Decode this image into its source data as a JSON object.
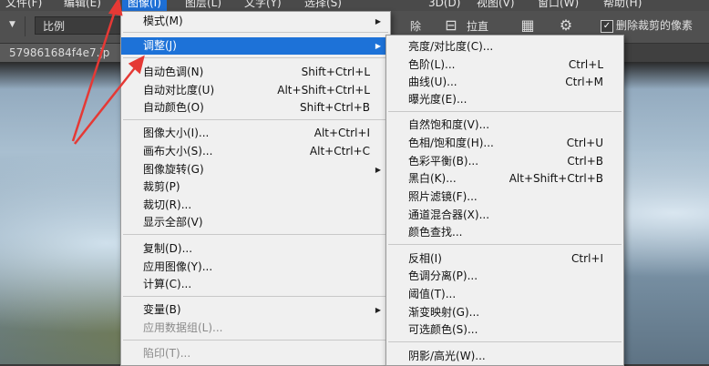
{
  "menubar": {
    "items": [
      "文件(F)",
      "编辑(E)",
      "图像(I)",
      "图层(L)",
      "文字(Y)",
      "选择(S)",
      "3D(D)",
      "视图(V)",
      "窗口(W)",
      "帮助(H)"
    ]
  },
  "options_bar": {
    "ratio_value": "比例",
    "delete_btn": "除",
    "straighten_btn": "拉直",
    "grid_icon": "grid-icon",
    "settings_icon": "gear-icon",
    "delete_cropped_checked": true,
    "delete_cropped_label": "删除裁剪的像素"
  },
  "document": {
    "tab_title": "579861684f4e7.jp"
  },
  "image_menu": {
    "items": [
      {
        "label": "模式(M)",
        "shortcut": "",
        "submenu": true
      },
      {
        "label": "调整(J)",
        "shortcut": "",
        "submenu": true
      },
      {
        "label": "自动色调(N)",
        "shortcut": "Shift+Ctrl+L"
      },
      {
        "label": "自动对比度(U)",
        "shortcut": "Alt+Shift+Ctrl+L"
      },
      {
        "label": "自动颜色(O)",
        "shortcut": "Shift+Ctrl+B"
      },
      {
        "label": "图像大小(I)...",
        "shortcut": "Alt+Ctrl+I"
      },
      {
        "label": "画布大小(S)...",
        "shortcut": "Alt+Ctrl+C"
      },
      {
        "label": "图像旋转(G)",
        "shortcut": "",
        "submenu": true
      },
      {
        "label": "裁剪(P)",
        "shortcut": ""
      },
      {
        "label": "裁切(R)...",
        "shortcut": ""
      },
      {
        "label": "显示全部(V)",
        "shortcut": ""
      },
      {
        "label": "复制(D)...",
        "shortcut": ""
      },
      {
        "label": "应用图像(Y)...",
        "shortcut": ""
      },
      {
        "label": "计算(C)...",
        "shortcut": ""
      },
      {
        "label": "变量(B)",
        "shortcut": "",
        "submenu": true
      },
      {
        "label": "应用数据组(L)...",
        "shortcut": "",
        "disabled": true
      },
      {
        "label": "陷印(T)...",
        "shortcut": "",
        "disabled": true
      }
    ]
  },
  "adjust_menu": {
    "items": [
      {
        "label": "亮度/对比度(C)...",
        "shortcut": ""
      },
      {
        "label": "色阶(L)...",
        "shortcut": "Ctrl+L"
      },
      {
        "label": "曲线(U)...",
        "shortcut": "Ctrl+M"
      },
      {
        "label": "曝光度(E)...",
        "shortcut": ""
      },
      {
        "label": "自然饱和度(V)...",
        "shortcut": ""
      },
      {
        "label": "色相/饱和度(H)...",
        "shortcut": "Ctrl+U"
      },
      {
        "label": "色彩平衡(B)...",
        "shortcut": "Ctrl+B"
      },
      {
        "label": "黑白(K)...",
        "shortcut": "Alt+Shift+Ctrl+B"
      },
      {
        "label": "照片滤镜(F)...",
        "shortcut": ""
      },
      {
        "label": "通道混合器(X)...",
        "shortcut": ""
      },
      {
        "label": "颜色查找...",
        "shortcut": ""
      },
      {
        "label": "反相(I)",
        "shortcut": "Ctrl+I"
      },
      {
        "label": "色调分离(P)...",
        "shortcut": ""
      },
      {
        "label": "阈值(T)...",
        "shortcut": ""
      },
      {
        "label": "渐变映射(G)...",
        "shortcut": ""
      },
      {
        "label": "可选颜色(S)...",
        "shortcut": ""
      },
      {
        "label": "阴影/高光(W)...",
        "shortcut": ""
      }
    ]
  },
  "colors": {
    "highlight": "#1d72d8",
    "annotation_arrow": "#e53935"
  }
}
